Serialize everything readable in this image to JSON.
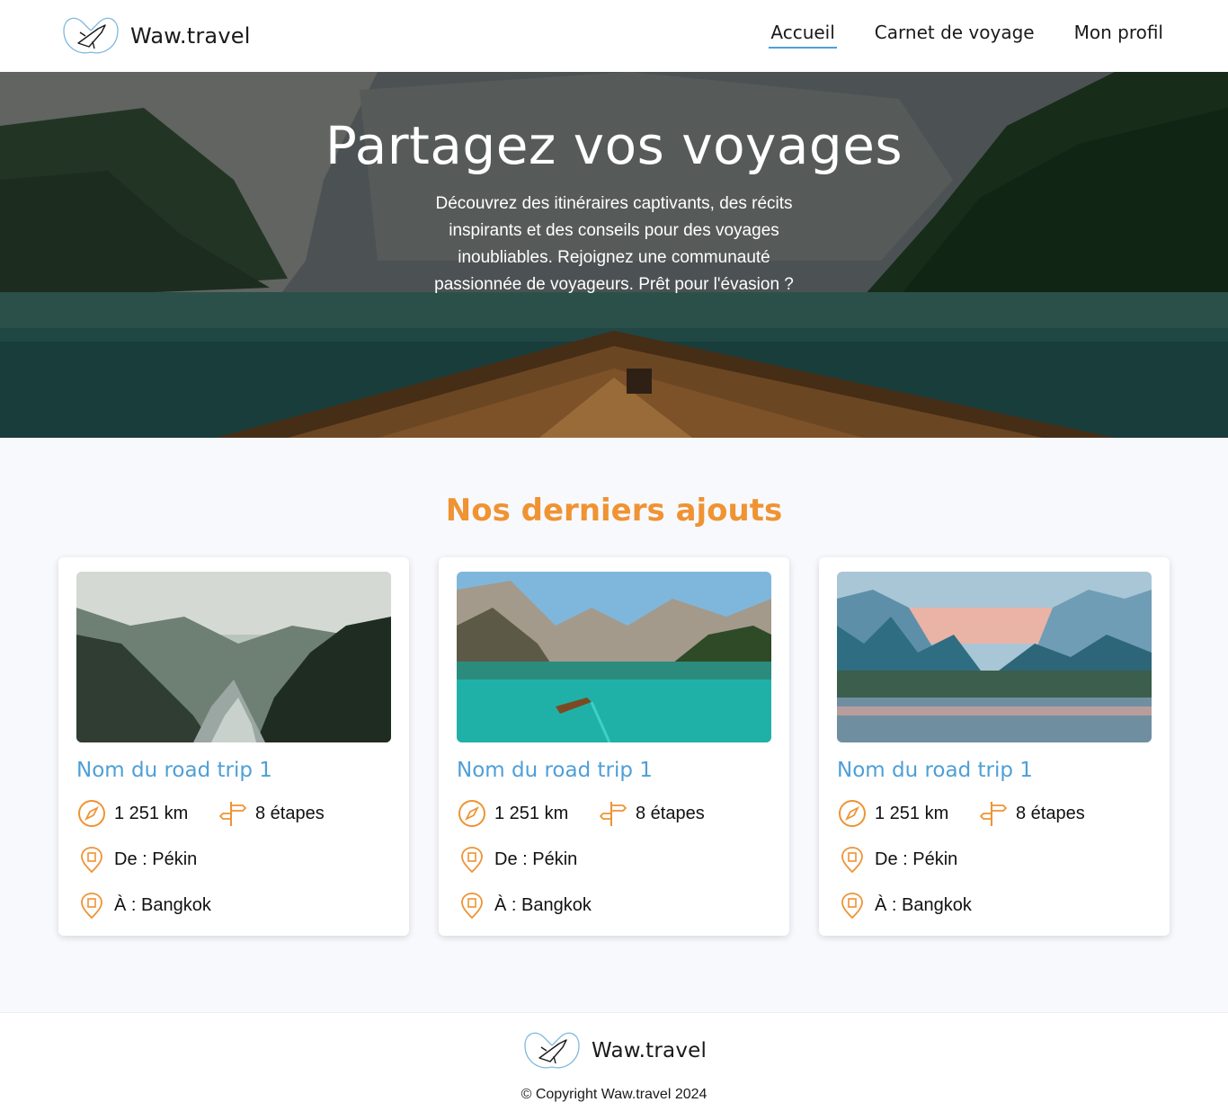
{
  "header": {
    "brand": "Waw.travel",
    "logo_icon": "plane-heart-logo",
    "nav": [
      {
        "label": "Accueil",
        "active": true
      },
      {
        "label": "Carnet de voyage",
        "active": false
      },
      {
        "label": "Mon profil",
        "active": false
      }
    ]
  },
  "hero": {
    "title": "Partagez vos voyages",
    "text": "Découvrez des itinéraires captivants, des récits inspirants et des conseils pour des voyages inoubliables. Rejoignez une communauté passionnée de voyageurs. Prêt pour l'évasion ?"
  },
  "latest": {
    "title": "Nos derniers ajouts",
    "cards": [
      {
        "title": "Nom du road trip 1",
        "distance": "1 251 km",
        "steps": "8 étapes",
        "from": "De : Pékin",
        "to": "À : Bangkok",
        "image": "misty-forest-river"
      },
      {
        "title": "Nom du road trip 1",
        "distance": "1 251 km",
        "steps": "8 étapes",
        "from": "De : Pékin",
        "to": "À : Bangkok",
        "image": "turquoise-mountain-lake-boat"
      },
      {
        "title": "Nom du road trip 1",
        "distance": "1 251 km",
        "steps": "8 étapes",
        "from": "De : Pékin",
        "to": "À : Bangkok",
        "image": "blue-mountain-river-sunset"
      }
    ]
  },
  "footer": {
    "brand": "Waw.travel",
    "copyright": "© Copyright Waw.travel 2024"
  },
  "colors": {
    "accent_orange": "#ef9333",
    "accent_blue": "#4e9fd6",
    "background": "#f8f9fd"
  }
}
